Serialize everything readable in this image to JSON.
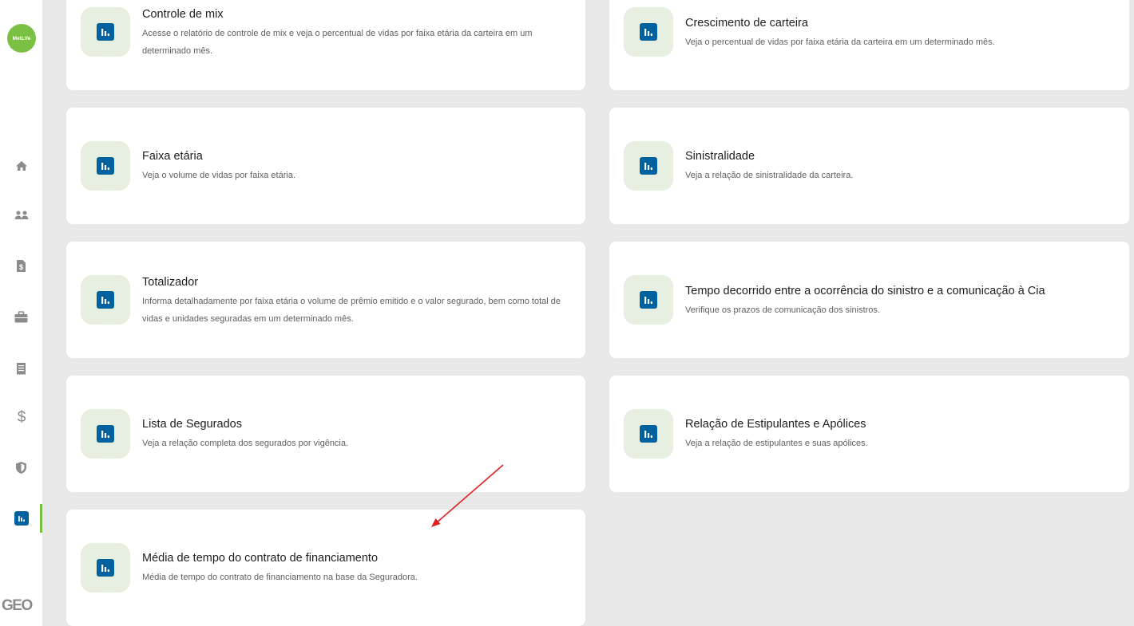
{
  "sidebar": {
    "logo": "MetLife",
    "brand_footer": "GEO",
    "items": [
      {
        "icon": "home-icon"
      },
      {
        "icon": "users-icon"
      },
      {
        "icon": "document-dollar-icon"
      },
      {
        "icon": "briefcase-icon"
      },
      {
        "icon": "receipt-icon"
      },
      {
        "icon": "dollar-icon"
      },
      {
        "icon": "shield-icon"
      },
      {
        "icon": "reports-chart-icon",
        "active": true
      }
    ]
  },
  "colors": {
    "brand_green": "#7ac143",
    "icon_blue": "#0061a0",
    "icon_bg": "#e6efe0",
    "annotation_arrow": "#e02020"
  },
  "cards": [
    {
      "title": "Controle de mix",
      "description": "Acesse o relatório de controle de mix e veja o percentual de vidas por faixa etária da carteira em um determinado mês.",
      "icon": "bar-chart-icon"
    },
    {
      "title": "Crescimento de carteira",
      "description": "Veja o percentual de vidas por faixa etária da carteira em um determinado mês.",
      "icon": "bar-chart-icon"
    },
    {
      "title": "Faixa etária",
      "description": "Veja o volume de vidas por faixa etária.",
      "icon": "bar-chart-icon"
    },
    {
      "title": "Sinistralidade",
      "description": "Veja a relação de sinistralidade da carteira.",
      "icon": "bar-chart-icon"
    },
    {
      "title": "Totalizador",
      "description": "Informa detalhadamente por faixa etária o volume de prêmio emitido e o valor segurado, bem como total de vidas e unidades seguradas em um determinado mês.",
      "icon": "bar-chart-icon"
    },
    {
      "title": "Tempo decorrido entre a ocorrência do sinistro e a comunicação à Cia",
      "description": "Verifique os prazos de comunicação dos sinistros.",
      "icon": "bar-chart-icon"
    },
    {
      "title": "Lista de Segurados",
      "description": "Veja a relação completa dos segurados por vigência.",
      "icon": "bar-chart-icon"
    },
    {
      "title": "Relação de Estipulantes e Apólices",
      "description": "Veja a relação de estipulantes e suas apólices.",
      "icon": "bar-chart-icon"
    },
    {
      "title": "Média de tempo do contrato de financiamento",
      "description": "Média de tempo do contrato de financiamento na base da Seguradora.",
      "icon": "bar-chart-icon"
    }
  ]
}
